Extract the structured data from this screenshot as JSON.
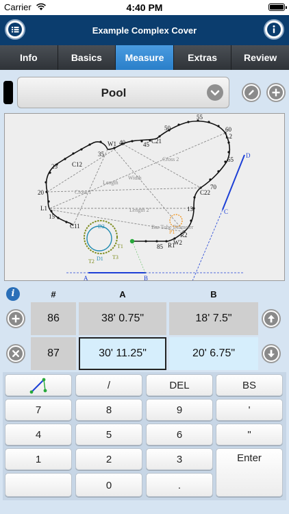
{
  "status": {
    "carrier": "Carrier",
    "time": "4:40 PM"
  },
  "nav": {
    "title": "Example Complex Cover"
  },
  "tabs": [
    "Info",
    "Basics",
    "Measure",
    "Extras",
    "Review"
  ],
  "active_tab": "Measure",
  "cover": {
    "name": "Pool"
  },
  "drawing": {
    "labels": {
      "p55": "55",
      "p60": "60",
      "p50": "50",
      "L2": "L2",
      "p45": "45",
      "C21": "C21",
      "W1": "W1",
      "p40": "40",
      "p35": "35",
      "C12": "C12",
      "p25": "25",
      "p20": "20",
      "L1": "L1",
      "p15": "15",
      "C11": "C11",
      "p65": "65",
      "p70": "70",
      "C22": "C22",
      "p13": "13",
      "R2": "R2",
      "W2": "W2",
      "R1": "R1",
      "p85": "85",
      "D": "D",
      "C": "C",
      "A": "A",
      "B": "B",
      "length": "Length",
      "width": "Width",
      "cross1": "Cross 1",
      "cross2": "Cross 2",
      "length2": "Length 2",
      "bar_diameter": "Bar Tube Diameter",
      "D2": "D2",
      "D1": "D1",
      "T1": "T1",
      "T2": "T2",
      "T3": "T3",
      "P1": "P1"
    }
  },
  "table": {
    "headers": {
      "num": "#",
      "a": "A",
      "b": "B"
    },
    "rows": [
      {
        "num": "86",
        "a": "38' 0.75\"",
        "b": "18' 7.5\""
      },
      {
        "num": "87",
        "a": "30' 11.25\"",
        "b": "20' 6.75\""
      }
    ]
  },
  "keypad": {
    "slash": "/",
    "del": "DEL",
    "bs": "BS",
    "k7": "7",
    "k8": "8",
    "k9": "9",
    "apos": "'",
    "k4": "4",
    "k5": "5",
    "k6": "6",
    "quote": "\"",
    "k1": "1",
    "k2": "2",
    "k3": "3",
    "enter": "Enter",
    "k0": "0",
    "dot": "."
  },
  "colors": {
    "nav": "#0b3d6e",
    "tab_active": "#2a7fc9",
    "selected_cell": "#d6eefc",
    "line_blue": "#1c3fd6"
  }
}
